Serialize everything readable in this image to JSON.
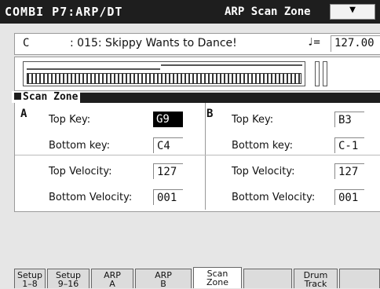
{
  "header": {
    "mode_page": "COMBI P7:ARP/DT",
    "page_tab": "ARP Scan Zone",
    "menu_icon": "chevron-down-icon"
  },
  "combination": {
    "bank": "C",
    "number_name": ": 015: Skippy Wants to Dance!",
    "tempo_symbol": "♩=",
    "tempo": "127.00"
  },
  "section": {
    "title": "Scan Zone"
  },
  "zone_a": {
    "letter": "A",
    "top_key_label": "Top Key:",
    "top_key": "G9",
    "bottom_key_label": "Bottom key:",
    "bottom_key": "C4",
    "top_vel_label": "Top Velocity:",
    "top_vel": "127",
    "bottom_vel_label": "Bottom Velocity:",
    "bottom_vel": "001"
  },
  "zone_b": {
    "letter": "B",
    "top_key_label": "Top Key:",
    "top_key": "B3",
    "bottom_key_label": "Bottom key:",
    "bottom_key": "C-1",
    "top_vel_label": "Top Velocity:",
    "top_vel": "127",
    "bottom_vel_label": "Bottom Velocity:",
    "bottom_vel": "001"
  },
  "tabs": [
    {
      "line1": "Setup",
      "line2": "1–8"
    },
    {
      "line1": "Setup",
      "line2": "9–16"
    },
    {
      "line1": "ARP",
      "line2": "A"
    },
    {
      "line1": "ARP",
      "line2": "B"
    },
    {
      "line1": "Scan",
      "line2": "Zone"
    },
    {
      "line1": "",
      "line2": ""
    },
    {
      "line1": "Drum",
      "line2": "Track"
    },
    {
      "line1": "",
      "line2": ""
    }
  ]
}
